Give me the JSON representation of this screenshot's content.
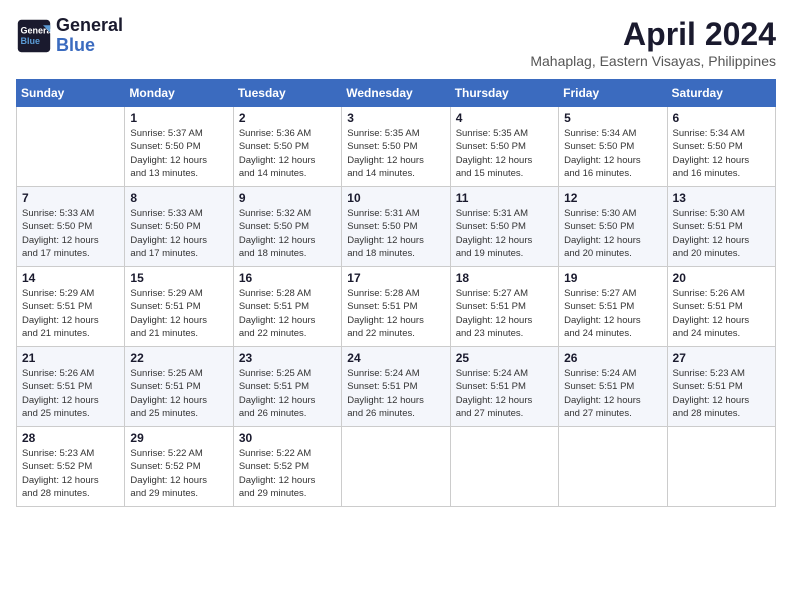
{
  "header": {
    "logo_line1": "General",
    "logo_line2": "Blue",
    "month_title": "April 2024",
    "location": "Mahaplag, Eastern Visayas, Philippines"
  },
  "days_of_week": [
    "Sunday",
    "Monday",
    "Tuesday",
    "Wednesday",
    "Thursday",
    "Friday",
    "Saturday"
  ],
  "weeks": [
    [
      {
        "day": "",
        "sunrise": "",
        "sunset": "",
        "daylight": ""
      },
      {
        "day": "1",
        "sunrise": "5:37 AM",
        "sunset": "5:50 PM",
        "daylight": "12 hours and 13 minutes."
      },
      {
        "day": "2",
        "sunrise": "5:36 AM",
        "sunset": "5:50 PM",
        "daylight": "12 hours and 14 minutes."
      },
      {
        "day": "3",
        "sunrise": "5:35 AM",
        "sunset": "5:50 PM",
        "daylight": "12 hours and 14 minutes."
      },
      {
        "day": "4",
        "sunrise": "5:35 AM",
        "sunset": "5:50 PM",
        "daylight": "12 hours and 15 minutes."
      },
      {
        "day": "5",
        "sunrise": "5:34 AM",
        "sunset": "5:50 PM",
        "daylight": "12 hours and 16 minutes."
      },
      {
        "day": "6",
        "sunrise": "5:34 AM",
        "sunset": "5:50 PM",
        "daylight": "12 hours and 16 minutes."
      }
    ],
    [
      {
        "day": "7",
        "sunrise": "5:33 AM",
        "sunset": "5:50 PM",
        "daylight": "12 hours and 17 minutes."
      },
      {
        "day": "8",
        "sunrise": "5:33 AM",
        "sunset": "5:50 PM",
        "daylight": "12 hours and 17 minutes."
      },
      {
        "day": "9",
        "sunrise": "5:32 AM",
        "sunset": "5:50 PM",
        "daylight": "12 hours and 18 minutes."
      },
      {
        "day": "10",
        "sunrise": "5:31 AM",
        "sunset": "5:50 PM",
        "daylight": "12 hours and 18 minutes."
      },
      {
        "day": "11",
        "sunrise": "5:31 AM",
        "sunset": "5:50 PM",
        "daylight": "12 hours and 19 minutes."
      },
      {
        "day": "12",
        "sunrise": "5:30 AM",
        "sunset": "5:50 PM",
        "daylight": "12 hours and 20 minutes."
      },
      {
        "day": "13",
        "sunrise": "5:30 AM",
        "sunset": "5:51 PM",
        "daylight": "12 hours and 20 minutes."
      }
    ],
    [
      {
        "day": "14",
        "sunrise": "5:29 AM",
        "sunset": "5:51 PM",
        "daylight": "12 hours and 21 minutes."
      },
      {
        "day": "15",
        "sunrise": "5:29 AM",
        "sunset": "5:51 PM",
        "daylight": "12 hours and 21 minutes."
      },
      {
        "day": "16",
        "sunrise": "5:28 AM",
        "sunset": "5:51 PM",
        "daylight": "12 hours and 22 minutes."
      },
      {
        "day": "17",
        "sunrise": "5:28 AM",
        "sunset": "5:51 PM",
        "daylight": "12 hours and 22 minutes."
      },
      {
        "day": "18",
        "sunrise": "5:27 AM",
        "sunset": "5:51 PM",
        "daylight": "12 hours and 23 minutes."
      },
      {
        "day": "19",
        "sunrise": "5:27 AM",
        "sunset": "5:51 PM",
        "daylight": "12 hours and 24 minutes."
      },
      {
        "day": "20",
        "sunrise": "5:26 AM",
        "sunset": "5:51 PM",
        "daylight": "12 hours and 24 minutes."
      }
    ],
    [
      {
        "day": "21",
        "sunrise": "5:26 AM",
        "sunset": "5:51 PM",
        "daylight": "12 hours and 25 minutes."
      },
      {
        "day": "22",
        "sunrise": "5:25 AM",
        "sunset": "5:51 PM",
        "daylight": "12 hours and 25 minutes."
      },
      {
        "day": "23",
        "sunrise": "5:25 AM",
        "sunset": "5:51 PM",
        "daylight": "12 hours and 26 minutes."
      },
      {
        "day": "24",
        "sunrise": "5:24 AM",
        "sunset": "5:51 PM",
        "daylight": "12 hours and 26 minutes."
      },
      {
        "day": "25",
        "sunrise": "5:24 AM",
        "sunset": "5:51 PM",
        "daylight": "12 hours and 27 minutes."
      },
      {
        "day": "26",
        "sunrise": "5:24 AM",
        "sunset": "5:51 PM",
        "daylight": "12 hours and 27 minutes."
      },
      {
        "day": "27",
        "sunrise": "5:23 AM",
        "sunset": "5:51 PM",
        "daylight": "12 hours and 28 minutes."
      }
    ],
    [
      {
        "day": "28",
        "sunrise": "5:23 AM",
        "sunset": "5:52 PM",
        "daylight": "12 hours and 28 minutes."
      },
      {
        "day": "29",
        "sunrise": "5:22 AM",
        "sunset": "5:52 PM",
        "daylight": "12 hours and 29 minutes."
      },
      {
        "day": "30",
        "sunrise": "5:22 AM",
        "sunset": "5:52 PM",
        "daylight": "12 hours and 29 minutes."
      },
      {
        "day": "",
        "sunrise": "",
        "sunset": "",
        "daylight": ""
      },
      {
        "day": "",
        "sunrise": "",
        "sunset": "",
        "daylight": ""
      },
      {
        "day": "",
        "sunrise": "",
        "sunset": "",
        "daylight": ""
      },
      {
        "day": "",
        "sunrise": "",
        "sunset": "",
        "daylight": ""
      }
    ]
  ],
  "labels": {
    "sunrise_label": "Sunrise:",
    "sunset_label": "Sunset:",
    "daylight_label": "Daylight:"
  }
}
